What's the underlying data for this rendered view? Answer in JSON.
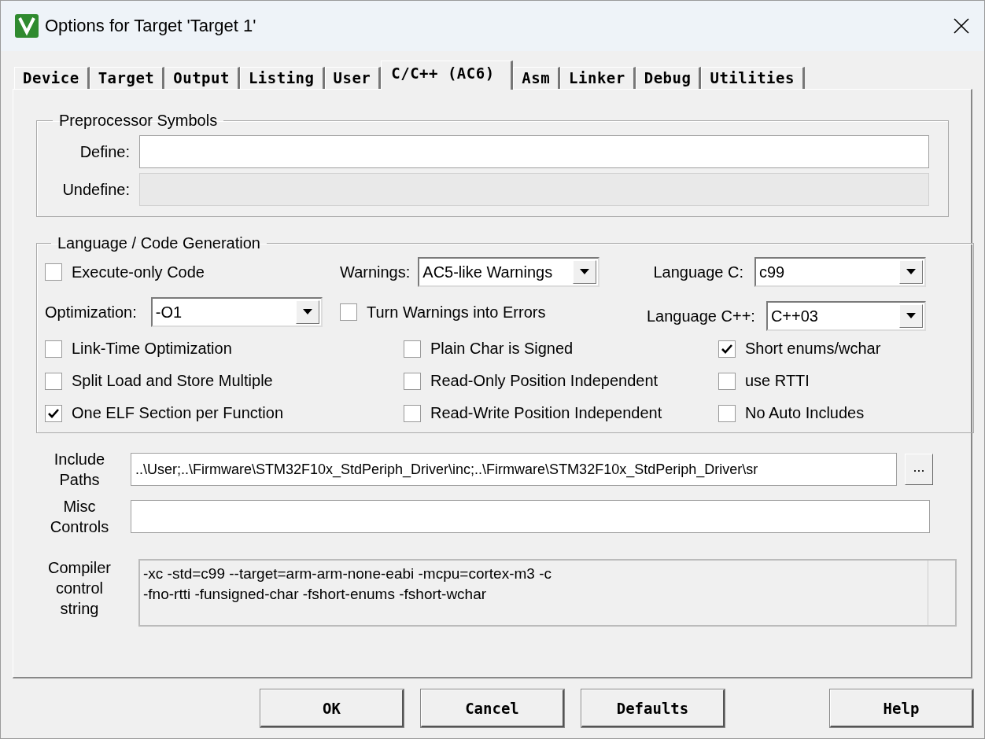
{
  "window": {
    "title": "Options for Target 'Target 1'"
  },
  "tabs": [
    {
      "label": "Device",
      "selected": false
    },
    {
      "label": "Target",
      "selected": false
    },
    {
      "label": "Output",
      "selected": false
    },
    {
      "label": "Listing",
      "selected": false
    },
    {
      "label": "User",
      "selected": false
    },
    {
      "label": "C/C++ (AC6)",
      "selected": true
    },
    {
      "label": "Asm",
      "selected": false
    },
    {
      "label": "Linker",
      "selected": false
    },
    {
      "label": "Debug",
      "selected": false
    },
    {
      "label": "Utilities",
      "selected": false
    }
  ],
  "preprocessor": {
    "title": "Preprocessor Symbols",
    "fields": [
      {
        "label": "Define:",
        "disabled": false
      },
      {
        "label": "Undefine:",
        "disabled": true
      }
    ]
  },
  "language": {
    "title": "Language / Code Generation",
    "execute_only": {
      "label": "Execute-only Code",
      "checked": false
    },
    "warnings": {
      "label": "Warnings:",
      "value": "AC5-like Warnings"
    },
    "language_c": {
      "label": "Language C:",
      "value": "c99"
    },
    "optimization": {
      "label": "Optimization:",
      "value": "-O1"
    },
    "turn_warnings": {
      "label": "Turn Warnings into Errors",
      "checked": false
    },
    "language_cpp": {
      "label": "Language C++:",
      "value": "C++03"
    },
    "columns": [
      [
        {
          "label": "Link-Time Optimization",
          "checked": false
        },
        {
          "label": "Split Load and Store Multiple",
          "checked": false
        },
        {
          "label": "One ELF Section per Function",
          "checked": true
        }
      ],
      [
        {
          "label": "Plain Char is Signed",
          "checked": false
        },
        {
          "label": "Read-Only Position Independent",
          "checked": false
        },
        {
          "label": "Read-Write Position Independent",
          "checked": false
        }
      ],
      [
        {
          "label": "Short enums/wchar",
          "checked": true
        },
        {
          "label": "use RTTI",
          "checked": false
        },
        {
          "label": "No Auto Includes",
          "checked": false
        }
      ]
    ]
  },
  "include_paths": {
    "label": "Include Paths",
    "value": "..\\User;..\\Firmware\\STM32F10x_StdPeriph_Driver\\inc;..\\Firmware\\STM32F10x_StdPeriph_Driver\\sr",
    "browse": "..."
  },
  "misc_controls": {
    "label": "Misc Controls"
  },
  "compiler_string": {
    "label": "Compiler control string",
    "lines": [
      "-xc -std=c99 --target=arm-arm-none-eabi -mcpu=cortex-m3 -c",
      "-fno-rtti -funsigned-char -fshort-enums -fshort-wchar"
    ]
  },
  "buttons": [
    "OK",
    "Cancel",
    "Defaults",
    "Help"
  ]
}
